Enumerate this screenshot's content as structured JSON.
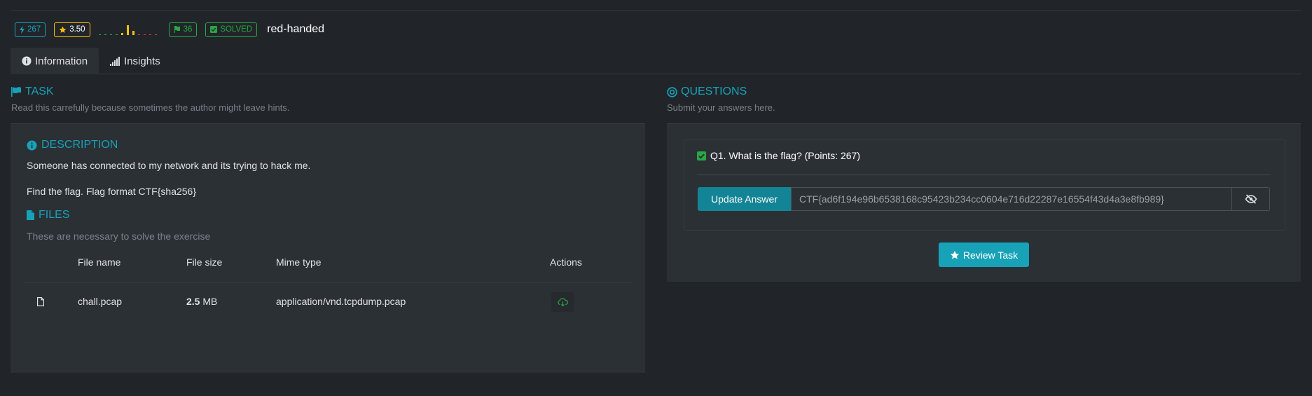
{
  "header": {
    "points": "267",
    "rating": "3.50",
    "solves": "36",
    "status": "SOLVED",
    "title": "red-handed"
  },
  "rating_distribution": [
    0,
    0,
    0,
    0,
    0.2,
    1,
    0.4,
    0,
    0,
    0,
    0
  ],
  "tabs": [
    {
      "label": "Information"
    },
    {
      "label": "Insights"
    }
  ],
  "task": {
    "heading": "TASK",
    "subtitle": "Read this carrefully because sometimes the author might leave hints."
  },
  "description": {
    "heading": "DESCRIPTION",
    "line1": "Someone has connected to my network and its trying to hack me.",
    "line2": "Find the flag. Flag format CTF{sha256}"
  },
  "files": {
    "heading": "FILES",
    "subtitle": "These are necessary to solve the exercise",
    "columns": [
      "File name",
      "File size",
      "Mime type",
      "Actions"
    ],
    "rows": [
      {
        "name": "chall.pcap",
        "size_value": "2.5",
        "size_unit": "MB",
        "mime": "application/vnd.tcpdump.pcap"
      }
    ]
  },
  "questions": {
    "heading": "QUESTIONS",
    "subtitle": "Submit your answers here.",
    "items": [
      {
        "label": "Q1. What is the flag? (Points: 267)",
        "answer": "CTF{ad6f194e96b6538168c95423b234cc0604e716d22287e16554f43d4a3e8fb989}"
      }
    ],
    "update_label": "Update Answer",
    "review_label": "Review Task"
  },
  "colors": {
    "accent": "#17a2b8",
    "warning": "#ffc107",
    "success": "#28a745",
    "danger": "#dc3545"
  }
}
